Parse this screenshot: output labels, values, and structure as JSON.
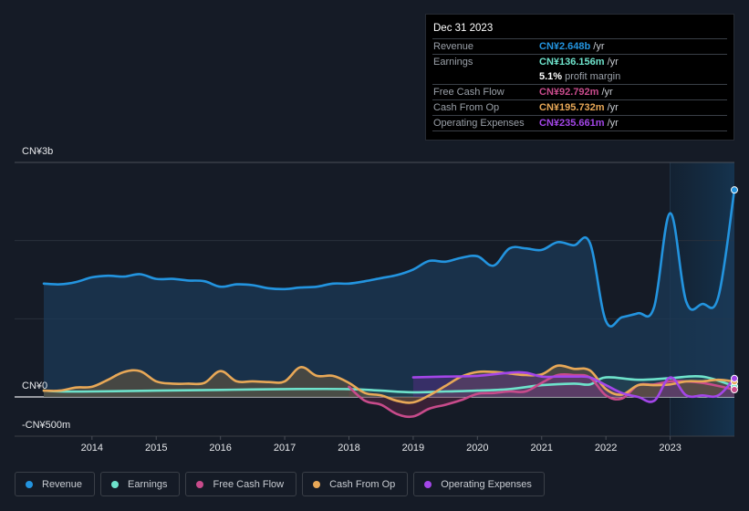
{
  "tooltip": {
    "date": "Dec 31 2023",
    "rows": [
      {
        "label": "Revenue",
        "value": "CN¥2.648b",
        "unit": "/yr",
        "color": "#2394df"
      },
      {
        "label": "Earnings",
        "value": "CN¥136.156m",
        "unit": "/yr",
        "color": "#6ee2cb"
      },
      {
        "label": "",
        "margin_value": "5.1%",
        "margin_text": "profit margin"
      },
      {
        "label": "Free Cash Flow",
        "value": "CN¥92.792m",
        "unit": "/yr",
        "color": "#c84b8b"
      },
      {
        "label": "Cash From Op",
        "value": "CN¥195.732m",
        "unit": "/yr",
        "color": "#e8a857"
      },
      {
        "label": "Operating Expenses",
        "value": "CN¥235.661m",
        "unit": "/yr",
        "color": "#a346e8"
      }
    ]
  },
  "legend": [
    {
      "label": "Revenue",
      "color": "#2394df"
    },
    {
      "label": "Earnings",
      "color": "#6ee2cb"
    },
    {
      "label": "Free Cash Flow",
      "color": "#c84b8b"
    },
    {
      "label": "Cash From Op",
      "color": "#e8a857"
    },
    {
      "label": "Operating Expenses",
      "color": "#a346e8"
    }
  ],
  "chart_data": {
    "type": "area",
    "title": "",
    "xlabel": "",
    "ylabel": "",
    "currency": "CN¥",
    "ylim": [
      -0.5,
      3.0
    ],
    "xlim": [
      2013.25,
      2024.0
    ],
    "y_tick_labels": [
      {
        "value": 3.0,
        "label": "CN¥3b"
      },
      {
        "value": 0,
        "label": "CN¥0"
      },
      {
        "value": -0.5,
        "label": "-CN¥500m"
      }
    ],
    "x_ticks": [
      2014,
      2015,
      2016,
      2017,
      2018,
      2019,
      2020,
      2021,
      2022,
      2023
    ],
    "gridlines": [
      1.0,
      2.0
    ],
    "grid": true,
    "highlight_from": 2023.0,
    "legend_position": "bottom-left",
    "units": "CN¥ billions",
    "series": [
      {
        "name": "Revenue",
        "color": "#2394df",
        "x": [
          2013.25,
          2013.5,
          2013.75,
          2014.0,
          2014.25,
          2014.5,
          2014.75,
          2015.0,
          2015.25,
          2015.5,
          2015.75,
          2016.0,
          2016.25,
          2016.5,
          2016.75,
          2017.0,
          2017.25,
          2017.5,
          2017.75,
          2018.0,
          2018.25,
          2018.5,
          2018.75,
          2019.0,
          2019.25,
          2019.5,
          2019.75,
          2020.0,
          2020.25,
          2020.5,
          2020.75,
          2021.0,
          2021.25,
          2021.5,
          2021.75,
          2022.0,
          2022.25,
          2022.5,
          2022.75,
          2023.0,
          2023.25,
          2023.5,
          2023.75,
          2024.0
        ],
        "values": [
          1.45,
          1.44,
          1.47,
          1.53,
          1.55,
          1.54,
          1.57,
          1.51,
          1.51,
          1.49,
          1.48,
          1.41,
          1.44,
          1.43,
          1.39,
          1.38,
          1.4,
          1.41,
          1.45,
          1.45,
          1.48,
          1.52,
          1.56,
          1.63,
          1.74,
          1.73,
          1.78,
          1.8,
          1.68,
          1.9,
          1.9,
          1.88,
          1.98,
          1.94,
          1.97,
          0.97,
          1.02,
          1.07,
          1.15,
          2.35,
          1.22,
          1.19,
          1.28,
          2.648
        ]
      },
      {
        "name": "Earnings",
        "color": "#6ee2cb",
        "x": [
          2013.25,
          2013.5,
          2014.0,
          2015.0,
          2016.0,
          2017.0,
          2018.0,
          2018.5,
          2019.0,
          2019.5,
          2020.0,
          2020.5,
          2021.0,
          2021.5,
          2021.75,
          2022.0,
          2022.5,
          2023.0,
          2023.5,
          2024.0
        ],
        "values": [
          0.08,
          0.07,
          0.07,
          0.08,
          0.09,
          0.1,
          0.1,
          0.08,
          0.06,
          0.07,
          0.08,
          0.1,
          0.15,
          0.17,
          0.16,
          0.25,
          0.22,
          0.24,
          0.26,
          0.136
        ]
      },
      {
        "name": "Free Cash Flow",
        "color": "#c84b8b",
        "x": [
          2018.0,
          2018.25,
          2018.5,
          2018.75,
          2019.0,
          2019.25,
          2019.5,
          2019.75,
          2020.0,
          2020.25,
          2020.5,
          2020.75,
          2021.0,
          2021.25,
          2021.5,
          2021.75,
          2022.0,
          2022.25,
          2022.5,
          2022.75,
          2023.0,
          2023.25,
          2023.5,
          2023.75,
          2024.0
        ],
        "values": [
          0.13,
          -0.05,
          -0.1,
          -0.22,
          -0.25,
          -0.15,
          -0.1,
          -0.04,
          0.04,
          0.05,
          0.07,
          0.07,
          0.18,
          0.28,
          0.28,
          0.25,
          0.02,
          -0.02,
          0.15,
          0.16,
          0.2,
          0.2,
          0.18,
          0.14,
          0.093
        ]
      },
      {
        "name": "Cash From Op",
        "color": "#e8a857",
        "x": [
          2013.25,
          2013.5,
          2013.75,
          2014.0,
          2014.25,
          2014.5,
          2014.75,
          2015.0,
          2015.25,
          2015.5,
          2015.75,
          2016.0,
          2016.25,
          2016.5,
          2016.75,
          2017.0,
          2017.25,
          2017.5,
          2017.75,
          2018.0,
          2018.25,
          2018.5,
          2018.75,
          2019.0,
          2019.25,
          2019.5,
          2019.75,
          2020.0,
          2020.25,
          2020.5,
          2020.75,
          2021.0,
          2021.25,
          2021.5,
          2021.75,
          2022.0,
          2022.25,
          2022.5,
          2022.75,
          2023.0,
          2023.25,
          2023.5,
          2023.75,
          2024.0
        ],
        "values": [
          0.08,
          0.08,
          0.12,
          0.13,
          0.22,
          0.32,
          0.33,
          0.2,
          0.17,
          0.17,
          0.18,
          0.33,
          0.2,
          0.2,
          0.19,
          0.2,
          0.38,
          0.27,
          0.27,
          0.18,
          0.05,
          0.02,
          -0.05,
          -0.07,
          0.02,
          0.14,
          0.26,
          0.32,
          0.32,
          0.3,
          0.28,
          0.29,
          0.4,
          0.36,
          0.34,
          0.1,
          0.03,
          0.15,
          0.15,
          0.16,
          0.2,
          0.2,
          0.22,
          0.196
        ]
      },
      {
        "name": "Operating Expenses",
        "color": "#a346e8",
        "x": [
          2019.0,
          2019.5,
          2020.0,
          2020.5,
          2020.75,
          2021.0,
          2021.25,
          2021.5,
          2021.75,
          2022.0,
          2022.25,
          2022.5,
          2022.75,
          2023.0,
          2023.25,
          2023.5,
          2023.75,
          2024.0
        ],
        "values": [
          0.25,
          0.26,
          0.27,
          0.31,
          0.31,
          0.26,
          0.26,
          0.26,
          0.25,
          0.15,
          0.05,
          0.0,
          -0.05,
          0.25,
          0.02,
          0.02,
          0.02,
          0.236
        ]
      }
    ]
  }
}
